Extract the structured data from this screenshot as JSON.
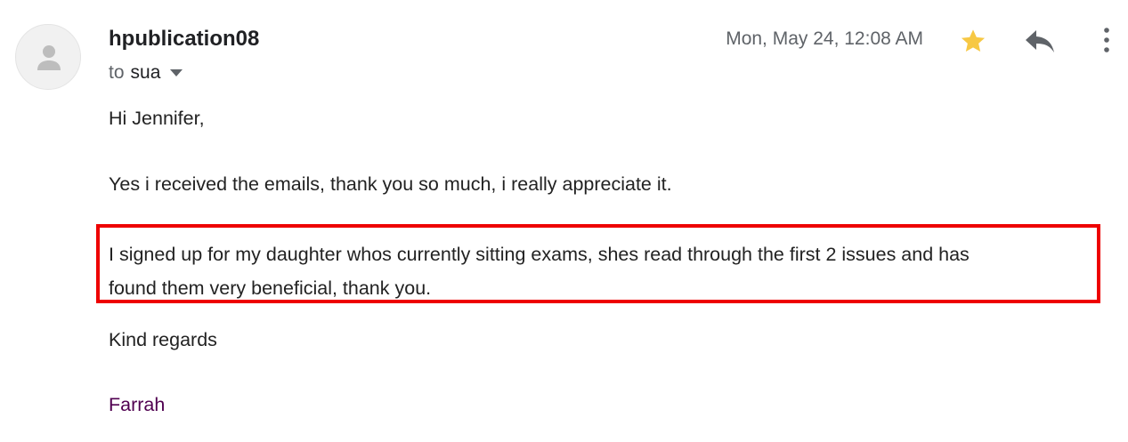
{
  "message": {
    "sender": "hpublication08",
    "to_label": "to",
    "recipient": "sua",
    "date": "Mon, May 24, 12:08 AM",
    "starred": true,
    "colors": {
      "star": "#f7c844",
      "highlight_border": "#ee0000",
      "signature": "#500050"
    },
    "icons": [
      "avatar-person-icon",
      "dropdown-arrow-icon",
      "star-icon",
      "reply-icon",
      "more-options-icon"
    ]
  },
  "body": {
    "greeting": "Hi Jennifer,",
    "paragraph1": "Yes i received the emails, thank you so much, i really appreciate it.",
    "paragraph2_line1": "I signed up for my daughter whos currently sitting exams, shes read through the first 2 issues and has",
    "paragraph2_line2": "found them very beneficial, thank you.",
    "closing": "Kind regards",
    "signature": "Farrah"
  }
}
